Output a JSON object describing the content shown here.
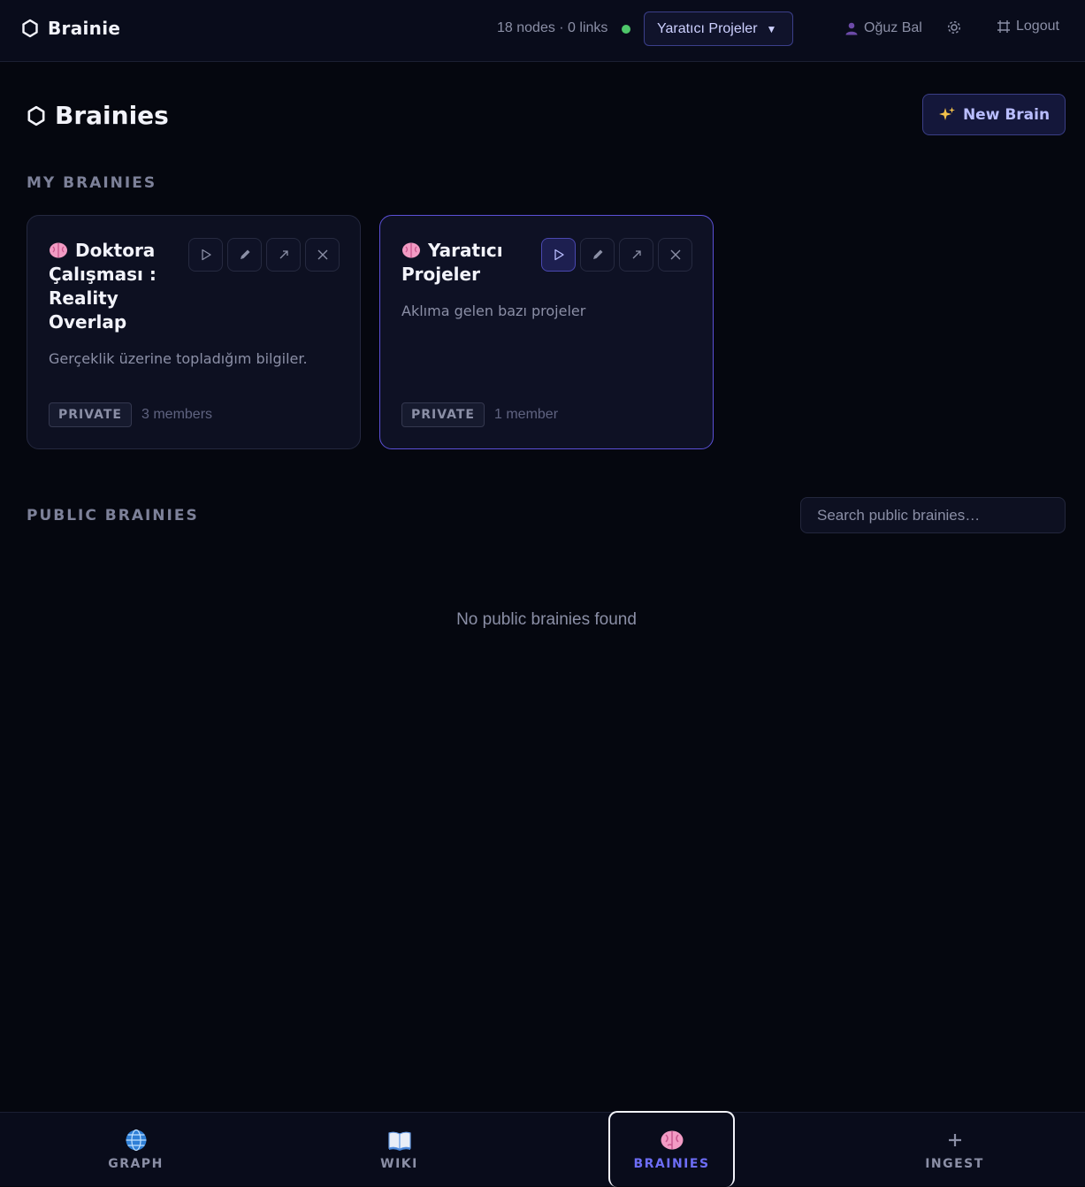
{
  "header": {
    "app_name": "Brainie",
    "stats": "18 nodes · 0 links",
    "status_color": "#4ec76a",
    "current_brain": "Yaratıcı Projeler",
    "user_name": "Oğuz Bal",
    "logout_label": "Logout"
  },
  "page": {
    "title": "Brainies",
    "new_brain_label": "New Brain",
    "my_section": "MY BRAINIES",
    "public_section": "PUBLIC BRAINIES",
    "search_placeholder": "Search public brainies…",
    "empty_text": "No public brainies found"
  },
  "cards": [
    {
      "title": "Doktora Çalışması : Reality Overlap",
      "description": "Gerçeklik üzerine topladığım bilgiler.",
      "visibility": "PRIVATE",
      "members": "3 members",
      "active": false
    },
    {
      "title": "Yaratıcı Projeler",
      "description": "Aklıma gelen bazı projeler",
      "visibility": "PRIVATE",
      "members": "1 member",
      "active": true
    }
  ],
  "nav": {
    "graph": "GRAPH",
    "wiki": "WIKI",
    "brainies": "BRAINIES",
    "ingest": "INGEST"
  },
  "colors": {
    "accent": "#6d6df5",
    "background": "#05070f"
  }
}
